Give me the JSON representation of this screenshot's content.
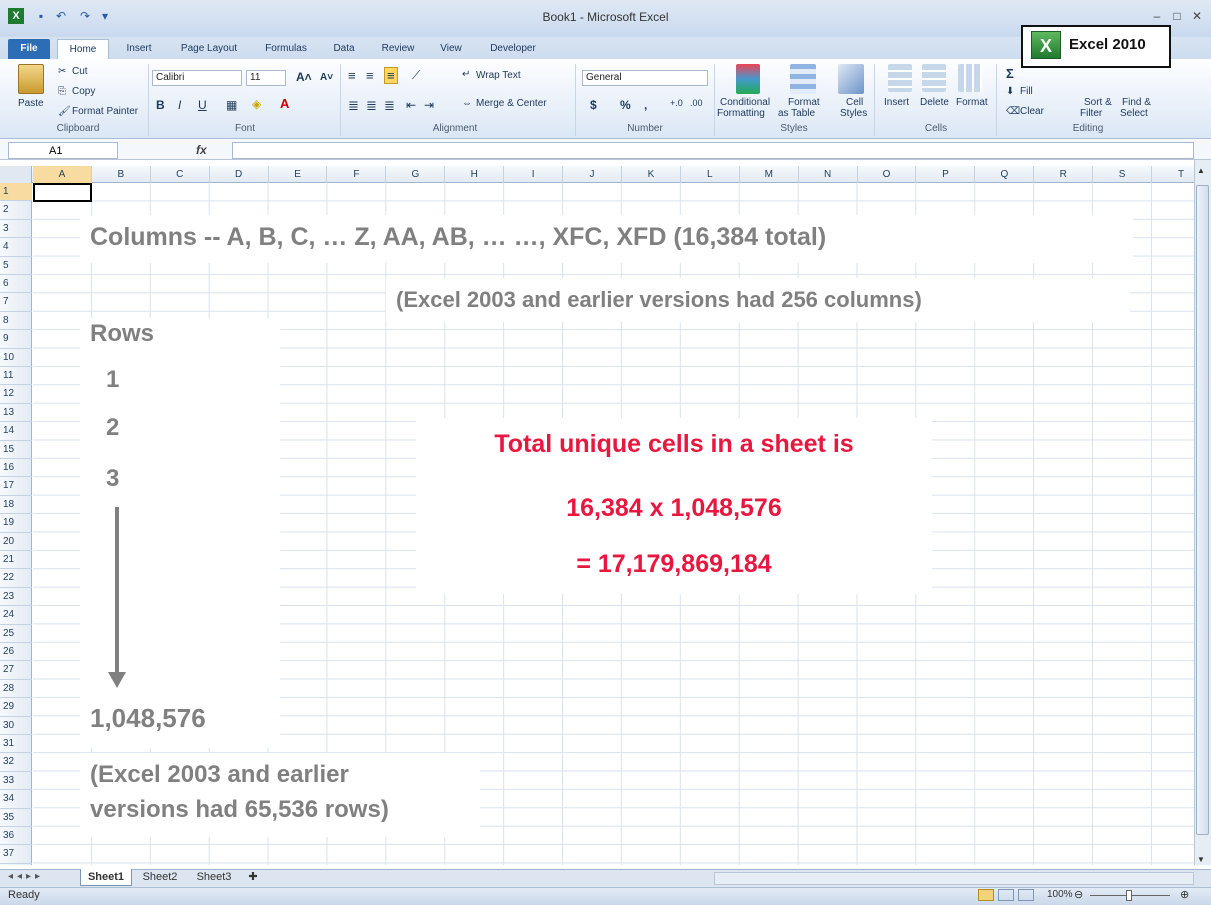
{
  "window": {
    "title": "Book1 - Microsoft Excel",
    "controls": [
      "–",
      "□",
      "✕"
    ]
  },
  "tabs": [
    "File",
    "Home",
    "Insert",
    "Page Layout",
    "Formulas",
    "Data",
    "Review",
    "View",
    "Developer"
  ],
  "ribbon": {
    "clipboard": {
      "paste": "Paste",
      "cut": "Cut",
      "copy": "Copy",
      "format_painter": "Format Painter",
      "label": "Clipboard"
    },
    "font": {
      "name": "Calibri",
      "size": "11",
      "label": "Font"
    },
    "alignment": {
      "wrap_text": "Wrap Text",
      "merge_center": "Merge & Center",
      "label": "Alignment"
    },
    "number": {
      "format": "General",
      "label": "Number"
    },
    "styles": {
      "conditional": "Conditional",
      "formatting": "Formatting",
      "format": "Format",
      "as_table": "as Table",
      "cell": "Cell",
      "cell_styles": "Styles",
      "label": "Styles"
    },
    "cells": {
      "insert": "Insert",
      "delete": "Delete",
      "format": "Format",
      "label": "Cells"
    },
    "editing": {
      "sum": "Σ",
      "fill": "Fill",
      "clear": "Clear",
      "sort_filter_1": "Sort &",
      "sort_filter_2": "Filter",
      "find_select_1": "Find &",
      "find_select_2": "Select",
      "label": "Editing"
    }
  },
  "badge": {
    "logo": "X",
    "text": "Excel 2010"
  },
  "formula_bar": {
    "name_box": "A1",
    "fx": "fx",
    "value": ""
  },
  "columns": [
    "A",
    "B",
    "C",
    "D",
    "E",
    "F",
    "G",
    "H",
    "I",
    "J",
    "K",
    "L",
    "M",
    "N",
    "O",
    "P",
    "Q",
    "R",
    "S",
    "T"
  ],
  "rows": [
    "1",
    "2",
    "3",
    "4",
    "5",
    "6",
    "7",
    "8",
    "9",
    "10",
    "11",
    "12",
    "13",
    "14",
    "15",
    "16",
    "17",
    "18",
    "19",
    "20",
    "21",
    "22",
    "23",
    "24",
    "25",
    "26",
    "27",
    "28",
    "29",
    "30",
    "31",
    "32",
    "33",
    "34",
    "35",
    "36",
    "37"
  ],
  "annotations": {
    "columns_line": "Columns -- A, B, C, … Z, AA, AB, …       …, XFC, XFD (16,384 total)",
    "columns_note": "(Excel 2003 and earlier versions had 256 columns)",
    "rows_title": "Rows",
    "row_1": "1",
    "row_2": "2",
    "row_3": "3",
    "rows_total": "1,048,576",
    "rows_note_1": "(Excel 2003 and earlier",
    "rows_note_2": "versions had 65,536 rows)",
    "total_1": "Total unique cells in a sheet is",
    "total_2": "16,384 x 1,048,576",
    "total_3": "= 17,179,869,184"
  },
  "sheets": [
    "Sheet1",
    "Sheet2",
    "Sheet3"
  ],
  "status": {
    "ready": "Ready",
    "zoom": "100%"
  }
}
